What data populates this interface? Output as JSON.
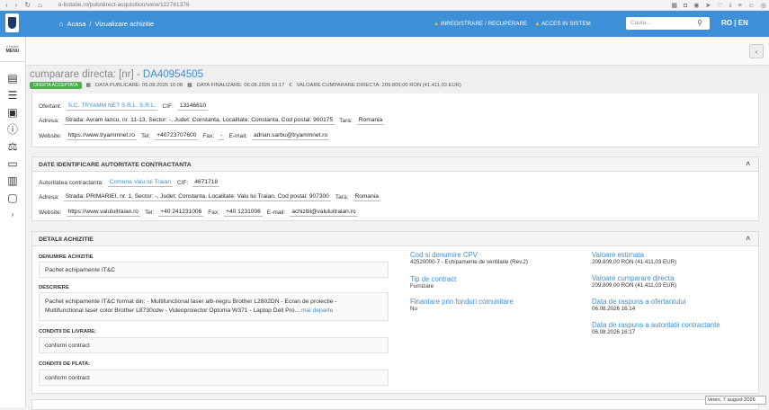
{
  "browser": {
    "url": "e-licitatie.ro/pub/direct-acquisition/view/122761376"
  },
  "topbar": {
    "home": "Acasa",
    "sep": "/",
    "page": "Vizualizare achizitie",
    "register": "INREGISTRARE / RECUPERARE",
    "access": "ACCES IN SISTEM",
    "search_placeholder": "Cauta...",
    "lang": "RO | EN"
  },
  "sidebar": {
    "menu_label": "MENU",
    "tiny": "e-licitatie"
  },
  "header": {
    "title_prefix": "cumparare directa: [nr] - ",
    "code": "DA40954505",
    "status": "OFERTA ACCEPTATA",
    "published": "DATA PUBLICARE: 06.08.2026 16:08",
    "finalized": "DATA FINALIZARE: 06.08.2026 16:17",
    "value": "VALOARE CUMPARARE DIRECTA: 209.809,00  RON (41.411,03  EUR)"
  },
  "ofertant": {
    "ofertant_label": "Ofertant:",
    "ofertant_value": "S.C. TRYAMM NET S.R.L. S.R.L.",
    "cif_label": "CIF:",
    "cif_value": "13146610",
    "address_label": "Adresa:",
    "address_value": "Strada: Avram Iancu, nr. 11-13, Sector: -, Judet: Constanta, Localitate: Constanta, Cod postal: 900175",
    "country_label": "Tara:",
    "country_value": "Romania",
    "website_label": "Website:",
    "website_value": "https://www.tryammnet.ro",
    "tel_label": "Tel:",
    "tel_value": "+40723707600",
    "fax_label": "Fax:",
    "fax_value": "-",
    "email_label": "E-mail:",
    "email_value": "adrian.sarbu@tryammnet.ro"
  },
  "authority": {
    "title": "DATE IDENTIFICARE AUTORITATE CONTRACTANTA",
    "name_label": "Autoritatea contractanta:",
    "name_value": "Comuna Valu lui Traian",
    "cif_label": "CIF:",
    "cif_value": "4671718",
    "address_label": "Adresa:",
    "address_value": "Strada: PRIMARIEI, nr. 1, Sector: -, Judet: Constanta, Localitate: Valu lui Traian, Cod postal: 907300",
    "country_label": "Tara:",
    "country_value": "Romania",
    "website_label": "Website:",
    "website_value": "https://www.valuluitraian.ro",
    "tel_label": "Tel:",
    "tel_value": "+40 241231006",
    "fax_label": "Fax:",
    "fax_value": "+40 1231006",
    "email_label": "E-mail:",
    "email_value": "achizitii@valuluitraian.ro"
  },
  "details": {
    "title": "DETALII ACHIZITIE",
    "name_label": "DENUMIRE ACHIZITIE",
    "name_value": "Pachet echipamente IT&C",
    "desc_label": "DESCRIERE",
    "desc_line1": "Pachet echipamente IT&C format din: - Multifunctional laser alb-negru Brother L2802DN - Ecran de proiectie -",
    "desc_line2": "Multifunctional laser color Brother L8730cdw - Videoproiector Optoma W371 - Laptop Dell Pro...",
    "more_link": "mai departe",
    "delivery_label": "CONDITII DE LIVRARE:",
    "delivery_value": "conform contract",
    "payment_label": "CONDITII DE PLATA:",
    "payment_value": "conform contract",
    "cpv_title": "Cod si denumire CPV",
    "cpv_value": "42520000-7 - Echipamente de ventilatie (Rev.2)",
    "contract_type_title": "Tip de contract",
    "contract_type_value": "Furnizare",
    "eu_funds_title": "Finantare prin fonduri comunitare",
    "eu_funds_value": "Nu",
    "estimated_title": "Valoare estimata",
    "estimated_value": "209.809,00  RON (41.411,03  EUR)",
    "direct_value_title": "Valoare cumparare directa",
    "direct_value_value": "209.809,00  RON (41.411,03  EUR)",
    "offer_reply_title": "Data de raspuns a ofertantului",
    "offer_reply_value": "06.08.2026 16:14",
    "authority_reply_title": "Data de raspuns a autoritatii contractante",
    "authority_reply_value": "06.08.2026 16:17"
  },
  "tooltip": "vineri, 7 august 2026"
}
